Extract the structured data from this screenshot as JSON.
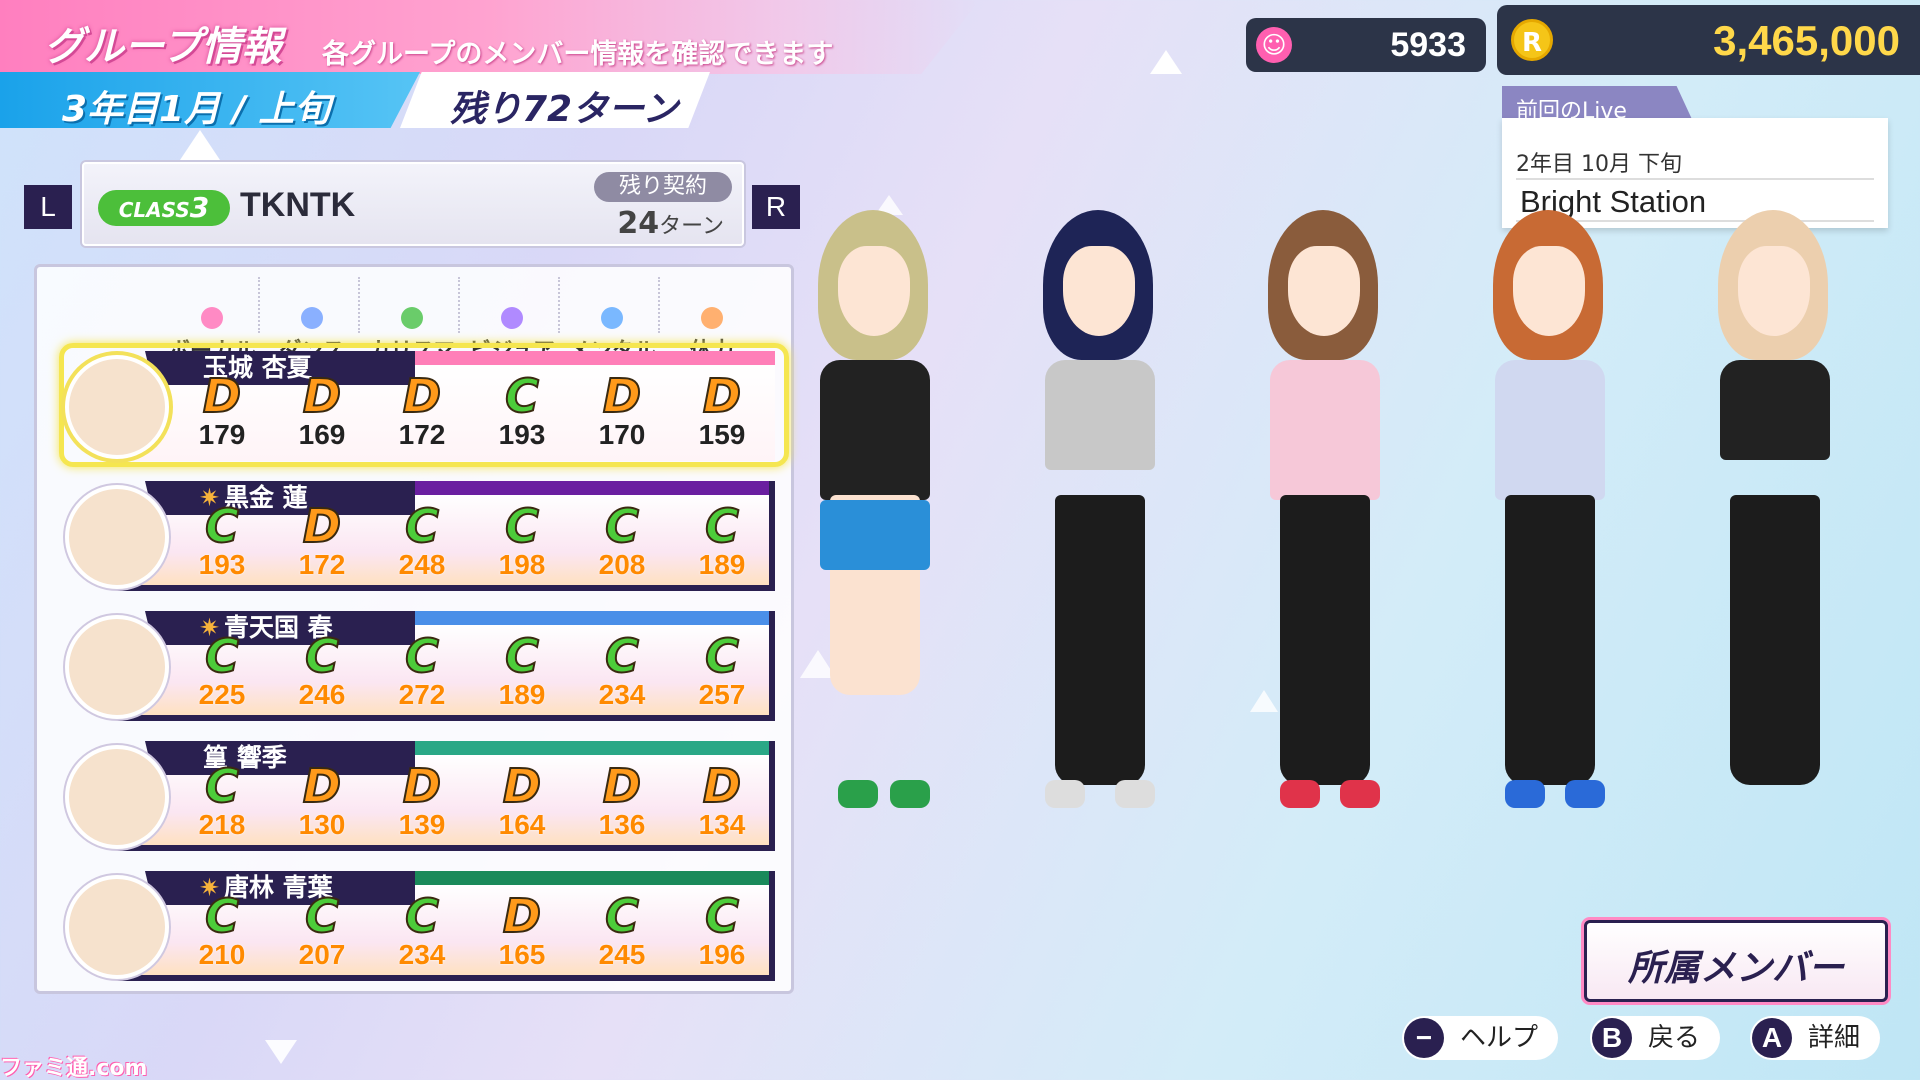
{
  "header": {
    "title": "グループ情報",
    "subtitle": "各グループのメンバー情報を確認できます",
    "date": "3年目1月 / 上旬",
    "turns_left": "残り72ターン"
  },
  "currency": {
    "fans": "5933",
    "money": "3,465,000",
    "fans_icon": "smile-icon",
    "money_icon": "coin-icon"
  },
  "last_live": {
    "label": "前回のLive",
    "date": "2年目 10月 下旬",
    "name": "Bright Station"
  },
  "group": {
    "prev_key": "L",
    "next_key": "R",
    "class_prefix": "CLASS",
    "class_num": "3",
    "name": "TKNTK",
    "contract_label": "残り契約",
    "contract_value": "24",
    "contract_unit": "ターン"
  },
  "stat_headers": [
    "ボーカル",
    "ダンス",
    "カリスマ",
    "ビジュアル",
    "メンタル",
    "体力"
  ],
  "members": [
    {
      "name": "玉城 杏夏",
      "star": "",
      "color": "#ff7fb8",
      "grades": [
        "D",
        "D",
        "D",
        "C",
        "D",
        "D"
      ],
      "values": [
        "179",
        "169",
        "172",
        "193",
        "170",
        "159"
      ]
    },
    {
      "name": "黒金 蓮",
      "star": "✷",
      "color": "#6a1fa0",
      "grades": [
        "C",
        "D",
        "C",
        "C",
        "C",
        "C"
      ],
      "values": [
        "193",
        "172",
        "248",
        "198",
        "208",
        "189"
      ]
    },
    {
      "name": "青天国 春",
      "star": "✷",
      "color": "#4a8fe8",
      "grades": [
        "C",
        "C",
        "C",
        "C",
        "C",
        "C"
      ],
      "values": [
        "225",
        "246",
        "272",
        "189",
        "234",
        "257"
      ]
    },
    {
      "name": "篁 響季",
      "star": "",
      "color": "#2aa886",
      "grades": [
        "C",
        "D",
        "D",
        "D",
        "D",
        "D"
      ],
      "values": [
        "218",
        "130",
        "139",
        "164",
        "136",
        "134"
      ]
    },
    {
      "name": "唐林 青葉",
      "star": "✷",
      "color": "#1a8a5a",
      "grades": [
        "C",
        "C",
        "C",
        "D",
        "C",
        "C"
      ],
      "values": [
        "210",
        "207",
        "234",
        "165",
        "245",
        "196"
      ]
    }
  ],
  "buttons": {
    "members": "所属メンバー",
    "help_key": "−",
    "help": "ヘルプ",
    "back_key": "B",
    "back": "戻る",
    "detail_key": "A",
    "detail": "詳細"
  },
  "watermark": "ファミ通.com"
}
